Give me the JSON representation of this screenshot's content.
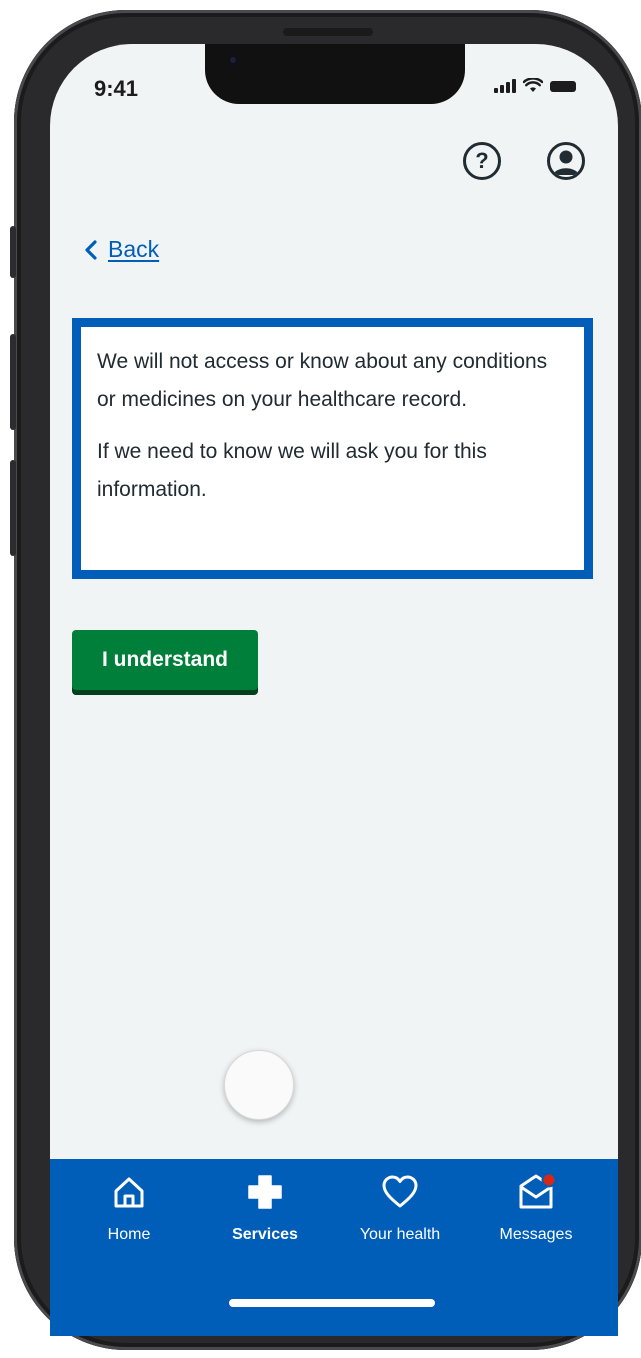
{
  "status_bar": {
    "time": "9:41"
  },
  "header": {
    "help_icon": "help-circle-icon",
    "profile_icon": "user-profile-icon",
    "help_glyph": "?"
  },
  "navigation": {
    "back_label": "Back"
  },
  "info_box": {
    "paragraphs": [
      "We will not access or know about any conditions or medicines on your healthcare record.",
      "If we need to know we will ask you for this information."
    ]
  },
  "actions": {
    "understand_label": "I understand"
  },
  "tab_bar": {
    "items": [
      {
        "label": "Home",
        "icon": "home-icon",
        "active": false
      },
      {
        "label": "Services",
        "icon": "services-cross-icon",
        "active": true
      },
      {
        "label": "Your health",
        "icon": "heart-icon",
        "active": false
      },
      {
        "label": "Messages",
        "icon": "messages-icon",
        "active": false
      }
    ]
  },
  "colors": {
    "nhs_blue": "#005eb8",
    "button_green": "#007f3b",
    "screen_background": "#f0f4f5",
    "text_dark": "#212b32",
    "notification_red": "#d5281b"
  }
}
